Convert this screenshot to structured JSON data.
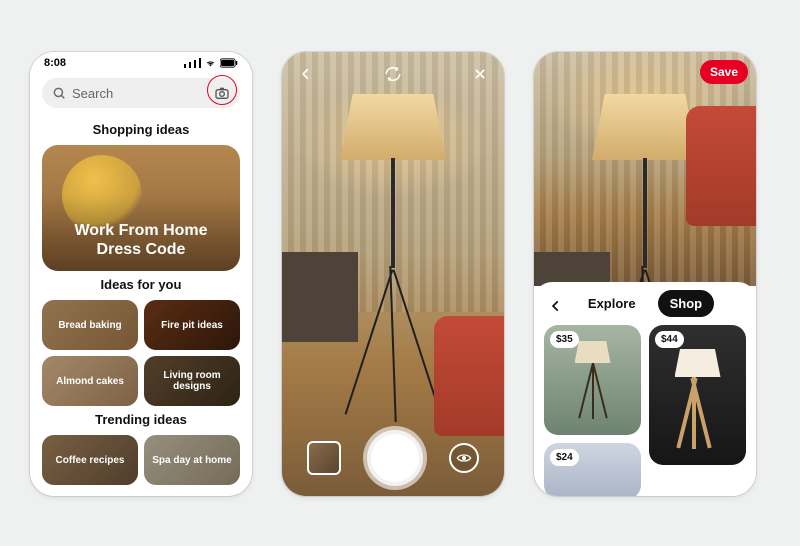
{
  "screen1": {
    "status_time": "8:08",
    "search_placeholder": "Search",
    "sections": {
      "shopping": "Shopping ideas",
      "ideas": "Ideas for you",
      "trending": "Trending ideas"
    },
    "hero_title": "Work From Home Dress Code",
    "tiles": {
      "bread": "Bread baking",
      "fire": "Fire pit ideas",
      "cake": "Almond cakes",
      "living": "Living room designs",
      "coffee": "Coffee recipes",
      "spa": "Spa day at home"
    }
  },
  "screen3": {
    "save_label": "Save",
    "tabs": {
      "explore": "Explore",
      "shop": "Shop"
    },
    "active_tab": "Shop",
    "results": [
      {
        "price": "$35"
      },
      {
        "price": "$44"
      },
      {
        "price": "$24"
      }
    ]
  },
  "colors": {
    "accent": "#e60023"
  }
}
